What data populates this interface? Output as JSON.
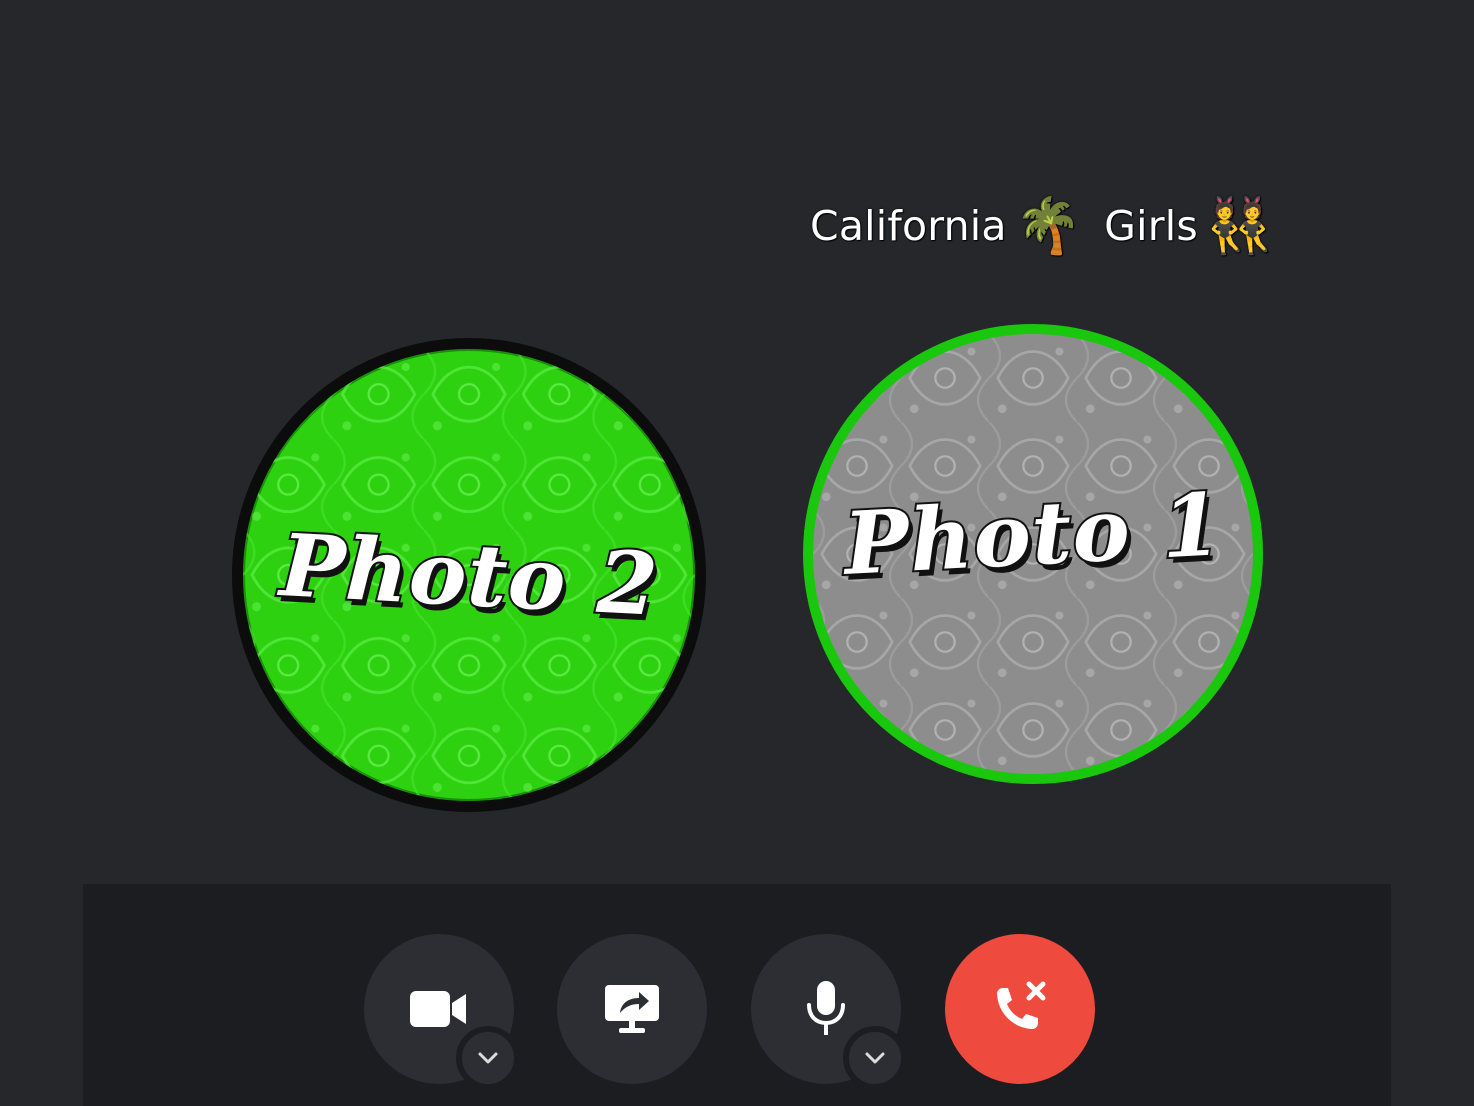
{
  "call": {
    "title_part1": "California",
    "title_emoji1": "🌴",
    "title_part2": "Girls",
    "title_emoji2": "👯"
  },
  "participants": [
    {
      "label": "Photo 2",
      "color": "#2ed10f",
      "ring_color": "#0c0c0c",
      "speaking": false
    },
    {
      "label": "Photo 1",
      "color": "#8d8d8d",
      "ring_color": "#19c70c",
      "speaking": true
    }
  ],
  "controls": {
    "camera": {
      "icon": "video-camera-icon",
      "has_menu": true
    },
    "screen_share": {
      "icon": "screen-share-icon"
    },
    "microphone": {
      "icon": "microphone-icon",
      "has_menu": true
    },
    "leave": {
      "icon": "end-call-icon",
      "color": "#ee4a3e"
    }
  },
  "colors": {
    "background": "#25272b",
    "control_bar": "#1c1d20",
    "button": "#2c2e33"
  }
}
